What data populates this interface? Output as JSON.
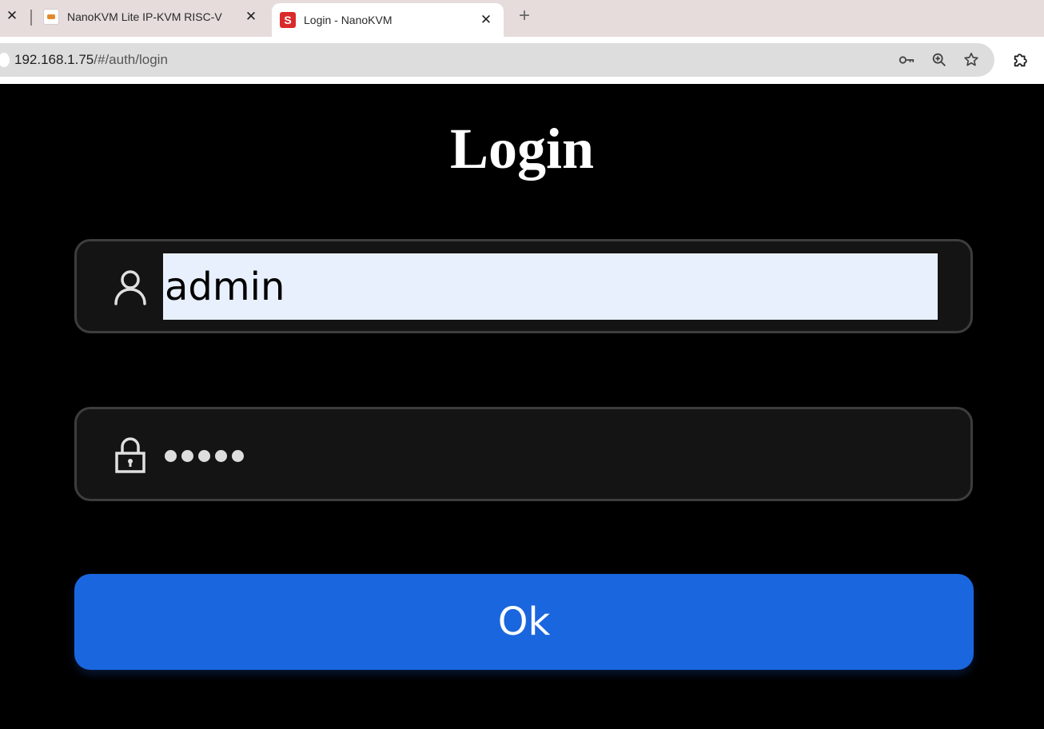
{
  "browser": {
    "tabs": [
      {
        "title": "NanoKVM Lite IP-KVM RISC-V",
        "favicon": "sipeed-favicon",
        "active": false
      },
      {
        "title": "Login - NanoKVM",
        "favicon": "nanokvm-favicon",
        "favicon_letter": "S",
        "active": true
      }
    ],
    "close_glyph": "✕",
    "new_tab_glyph": "+",
    "address": {
      "host": "192.168.1.75",
      "path": "/#/auth/login"
    },
    "omnibox_icons": [
      "key-icon",
      "zoom-icon",
      "bookmark-star-icon"
    ],
    "toolbar_icons": [
      "extensions-puzzle-icon"
    ]
  },
  "login": {
    "title": "Login",
    "username": {
      "value": "admin",
      "icon": "user-icon"
    },
    "password": {
      "masked_length": 5,
      "icon": "lock-icon"
    },
    "submit_label": "Ok"
  },
  "colors": {
    "background": "#000000",
    "field_bg": "#141414",
    "field_border": "#3d3d3d",
    "autofill_bg": "#e8f0fe",
    "button_blue": "#1a66de",
    "tabstrip": "#e6dcdc"
  }
}
